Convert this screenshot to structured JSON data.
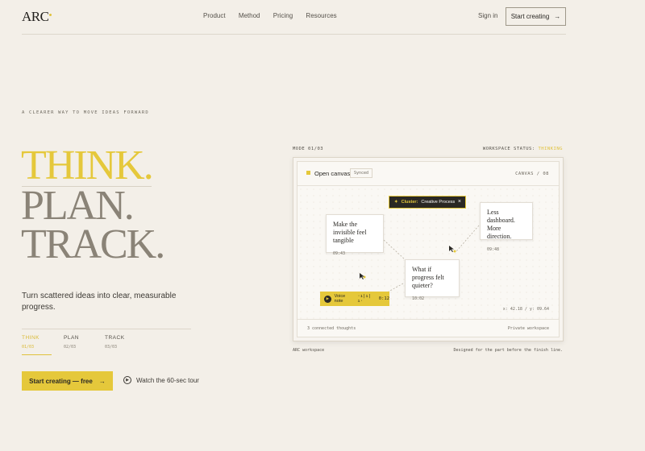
{
  "header": {
    "logo": "ARC",
    "nav": [
      "Product",
      "Method",
      "Pricing",
      "Resources"
    ],
    "signin": "Sign in",
    "cta": "Start creating",
    "cta_arrow": "→"
  },
  "hero": {
    "eyebrow": "A CLEARER WAY TO MOVE IDEAS FORWARD",
    "lines": [
      "THINK.",
      "PLAN.",
      "TRACK."
    ],
    "lede": "Turn scattered ideas into clear, measurable progress.",
    "steps": [
      {
        "label": "THINK",
        "num": "01/03"
      },
      {
        "label": "PLAN",
        "num": "02/03"
      },
      {
        "label": "TRACK",
        "num": "03/03"
      }
    ],
    "cta": "Start creating — free",
    "cta_arrow": "→",
    "tour": "Watch the 60-sec tour"
  },
  "panel": {
    "mode": "MODE 01/03",
    "status_label": "WORKSPACE STATUS:",
    "status_value": "THINKING",
    "header_title": "Open canvas",
    "header_badge": "Synced",
    "canvas_no": "CANVAS / 08",
    "cards": [
      {
        "title": "Make the invisible feel tangible",
        "time": "09:43"
      },
      {
        "title": "Less dashboard. More direction.",
        "time": "09:48"
      },
      {
        "title": "What if progress felt quieter?",
        "time": "10:02"
      }
    ],
    "cluster_prefix": "Cluster:",
    "cluster_name": "Creative Process",
    "voice_label": "Voice note",
    "voice_wave": "·ı|ı|ı·",
    "voice_time": "0:12",
    "coords": "x: 42.18 / y: 09.64",
    "footer_left": "3 connected thoughts",
    "footer_right": "Private workspace",
    "caption_left": "ARC workspace",
    "caption_right": "Designed for the part before the finish line."
  }
}
